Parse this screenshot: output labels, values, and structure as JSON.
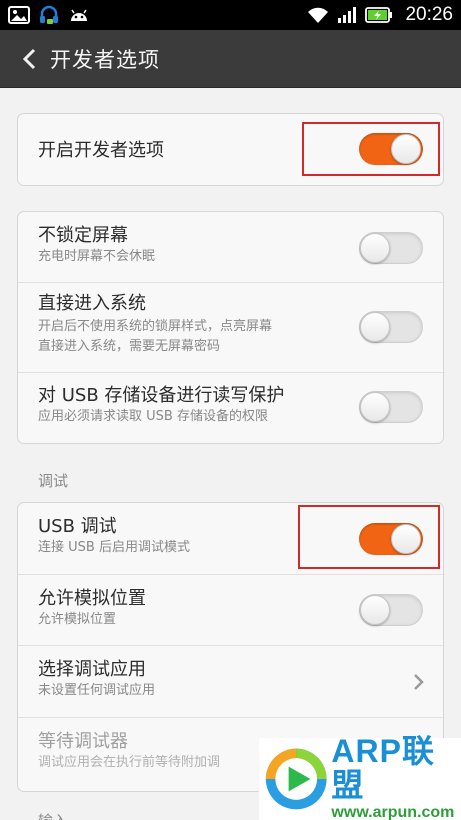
{
  "status_bar": {
    "time": "20:26",
    "icons": [
      "image-icon",
      "headset-icon",
      "android-icon",
      "wifi-icon",
      "signal-icon",
      "battery-icon"
    ]
  },
  "title_bar": {
    "back_icon": "chevron-left-icon",
    "title": "开发者选项"
  },
  "developer_toggle": {
    "title": "开启开发者选项",
    "on": true
  },
  "group1": [
    {
      "title": "不锁定屏幕",
      "subtitle": "充电时屏幕不会休眠",
      "on": false
    },
    {
      "title": "直接进入系统",
      "subtitle_line1": "开启后不使用系统的锁屏样式，点亮屏幕",
      "subtitle_line2": "直接进入系统，需要无屏幕密码",
      "on": false
    },
    {
      "title": "对 USB 存储设备进行读写保护",
      "subtitle": "应用必须请求读取 USB 存储设备的权限",
      "on": false
    }
  ],
  "section_debug": {
    "label": "调试"
  },
  "group2": [
    {
      "title": "USB 调试",
      "subtitle": "连接 USB 后启用调试模式",
      "on": true
    },
    {
      "title": "允许模拟位置",
      "subtitle": "允许模拟位置",
      "on": false
    },
    {
      "title": "选择调试应用",
      "subtitle": "未设置任何调试应用",
      "chevron": "chevron-right-icon"
    },
    {
      "title": "等待调试器",
      "subtitle": "调试应用会在执行前等待附加调"
    }
  ],
  "next_section_label": "输入",
  "watermark": {
    "brand": "ARP联盟",
    "url": "www.arpun.com"
  },
  "colors": {
    "accent": "#f06414",
    "highlight": "#d22a2a",
    "titlebar": "#3b3b3b"
  }
}
